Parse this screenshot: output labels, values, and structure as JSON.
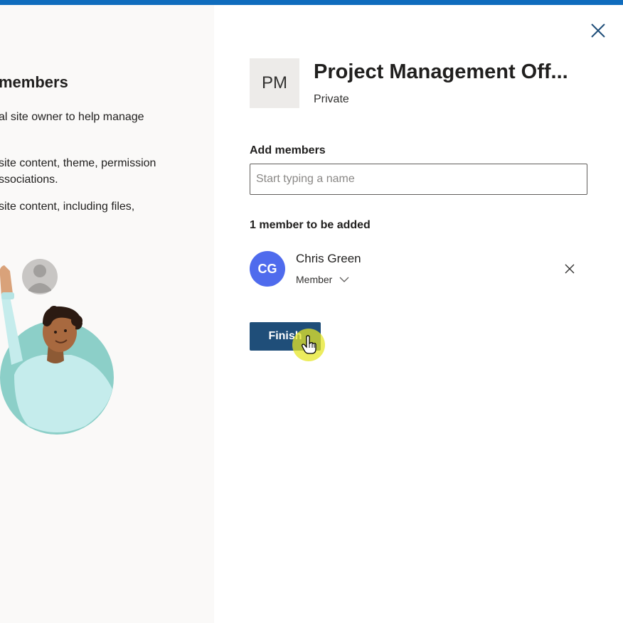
{
  "left": {
    "title": "members",
    "text_lines": [
      "al site owner to help manage",
      "site content, theme, permission",
      "ssociations.",
      "site content, including files,"
    ]
  },
  "site": {
    "initials": "PM",
    "name": "Project Management Off...",
    "privacy": "Private"
  },
  "add_members": {
    "label": "Add members",
    "placeholder": "Start typing a name",
    "value": ""
  },
  "members": {
    "count_label": "1 member to be added",
    "items": [
      {
        "initials": "CG",
        "name": "Chris Green",
        "role": "Member",
        "avatar_color": "#4f6bed"
      }
    ]
  },
  "actions": {
    "finish_label": "Finish"
  },
  "icons": {
    "close": "close-icon",
    "remove": "remove-icon",
    "dropdown": "chevron-down-icon",
    "cursor": "hand-pointer-icon"
  },
  "colors": {
    "topbar": "#0f6cbd",
    "finish_button": "#1f4e79",
    "avatar": "#4f6bed",
    "left_pane_bg": "#faf9f8"
  }
}
